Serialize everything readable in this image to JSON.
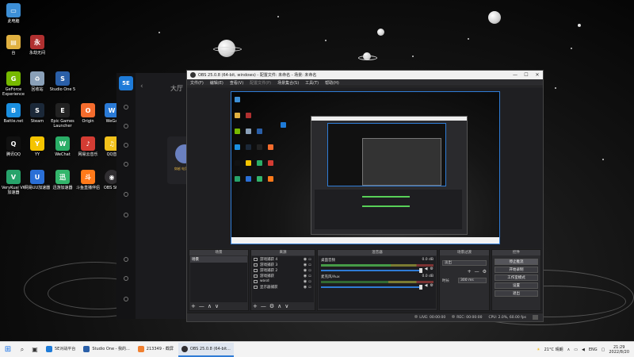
{
  "desktop": {
    "icons": [
      {
        "label": "此电脑",
        "color": "#3d8fd6",
        "glyph": "▭"
      },
      {
        "label": "台",
        "color": "#e0b040",
        "glyph": "▤"
      },
      {
        "label": "永劫无间",
        "color": "#b03030",
        "glyph": "永"
      },
      {
        "label": "GeForce Experience",
        "color": "#76b900",
        "glyph": "G"
      },
      {
        "label": "回收站",
        "color": "#8aa0b8",
        "glyph": "♻"
      },
      {
        "label": "Studio One 5",
        "color": "#2a5fa8",
        "glyph": "S"
      },
      {
        "label": "Battle.net",
        "color": "#1a8fe0",
        "glyph": "B"
      },
      {
        "label": "Steam",
        "color": "#1b2838",
        "glyph": "S"
      },
      {
        "label": "Epic Games Launcher",
        "color": "#222222",
        "glyph": "E"
      },
      {
        "label": "Origin",
        "color": "#f56c2d",
        "glyph": "O"
      },
      {
        "label": "WeGa",
        "color": "#2a7ad6",
        "glyph": "W"
      },
      {
        "label": "腾讯QQ",
        "color": "#111111",
        "glyph": "Q"
      },
      {
        "label": "YY",
        "color": "#f5c400",
        "glyph": "Y"
      },
      {
        "label": "WeChat",
        "color": "#2aae67",
        "glyph": "W"
      },
      {
        "label": "网易云音乐",
        "color": "#d43c33",
        "glyph": "♪"
      },
      {
        "label": "QQ音",
        "color": "#f2c21b",
        "glyph": "♫"
      },
      {
        "label": "VeryKuai VK加速器",
        "color": "#27a36b",
        "glyph": "V"
      },
      {
        "label": "网易UU加速器",
        "color": "#2a6fd6",
        "glyph": "U"
      },
      {
        "label": "迅游加速器",
        "color": "#33b56b",
        "glyph": "迅"
      },
      {
        "label": "斗鱼直播伴侣",
        "color": "#ff7a1a",
        "glyph": "斗"
      },
      {
        "label": "OBS Stu",
        "color": "#302e31",
        "glyph": "◉"
      }
    ]
  },
  "app5e": {
    "logo": "5E",
    "hall_label": "大厅",
    "back_glyph": "‹",
    "card_label": "穿越 电竞 地图"
  },
  "obs": {
    "window_title": "OBS 25.0.8 (64-bit, windows) - 配置文件: 未命名 - 场景: 未命名",
    "controls": {
      "minimize": "—",
      "maximize": "☐",
      "close": "✕"
    },
    "menu": [
      "文件(F)",
      "编辑(E)",
      "查看(V)",
      "配置文件(P)",
      "场景集合(S)",
      "工具(T)",
      "帮助(H)"
    ],
    "docks": {
      "scenes": {
        "title": "场景",
        "items": [
          "场景"
        ]
      },
      "sources": {
        "title": "来源",
        "items": [
          "游戏捕获 4",
          "游戏捕获 3",
          "游戏捕获 2",
          "游戏捕获",
          "wasd",
          "显示器捕获"
        ]
      },
      "mixer": {
        "title": "混音器",
        "tracks": [
          {
            "name": "桌面音频",
            "db": "0.0 dB"
          },
          {
            "name": "麦克风/Aux",
            "db": "0.0 dB"
          }
        ]
      },
      "transitions": {
        "title": "场景过渡",
        "type": "淡出",
        "duration_label": "时长",
        "duration_value": "300 ms"
      },
      "controls": {
        "title": "控件",
        "buttons": [
          "停止推流",
          "开始录制",
          "工作室模式",
          "设置",
          "退出"
        ]
      }
    },
    "tool_glyphs": {
      "add": "+",
      "remove": "—",
      "up": "∧",
      "down": "∨",
      "gear": "⚙"
    },
    "status": {
      "live": "LIVE: 00:00:00",
      "rec": "REC: 00:00:00",
      "cpu": "CPU: 2.0%, 60.00 fps"
    }
  },
  "taskbar": {
    "start_glyph": "⊞",
    "search_glyph": "⌕",
    "taskview_glyph": "▣",
    "apps": [
      {
        "label": "5E对战平台",
        "color": "#1e7bd8",
        "active": false
      },
      {
        "label": "Studio One - 我的...",
        "color": "#2a5fa8",
        "active": false
      },
      {
        "label": "213349 - 截屏",
        "color": "#f08030",
        "active": false
      },
      {
        "label": "OBS 25.0.8 (64-bit...",
        "color": "#302e31",
        "active": true
      }
    ],
    "tray": {
      "weather": "21°C 晴朗",
      "lang": "ENG",
      "time": "21:29",
      "date": "2022/8/20"
    }
  }
}
